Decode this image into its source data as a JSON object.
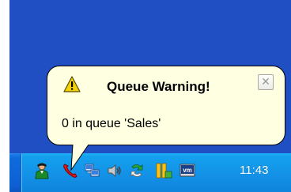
{
  "balloon": {
    "title": "Queue Warning!",
    "message": "0 in queue 'Sales'",
    "close_glyph": "✕",
    "icon": "warning-icon"
  },
  "taskbar": {
    "clock": "11:43",
    "tray_icons": [
      "agent-person-icon",
      "phone-handset-icon",
      "network-connection-icon",
      "volume-speaker-icon",
      "recycle-arrows-icon",
      "app-windows-icon",
      "vmware-icon"
    ],
    "vm_icon_text": "vm"
  },
  "colors": {
    "desktop": "#1f4fc2",
    "taskbar": "#0e60d2",
    "tray": "#1390e6",
    "balloon_bg": "#ffffe1"
  }
}
